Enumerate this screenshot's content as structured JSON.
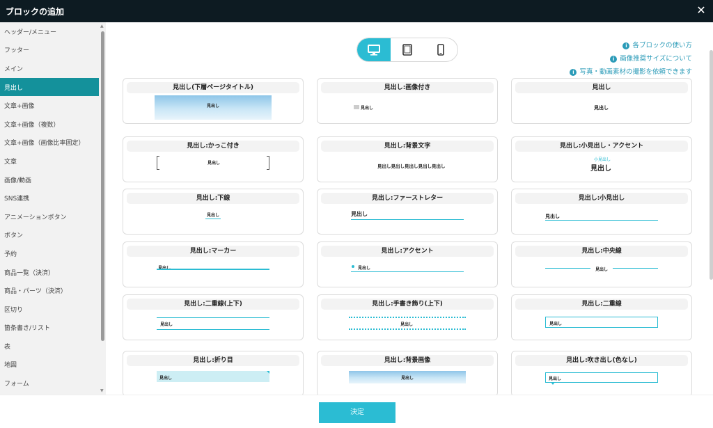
{
  "window": {
    "title": "ブロックの追加"
  },
  "sidebar": {
    "items": [
      {
        "label": "ヘッダー/メニュー"
      },
      {
        "label": "フッター"
      },
      {
        "label": "メイン"
      },
      {
        "label": "見出し",
        "active": true
      },
      {
        "label": "文章+画像"
      },
      {
        "label": "文章+画像（複数）"
      },
      {
        "label": "文章+画像（画像比率固定）"
      },
      {
        "label": "文章"
      },
      {
        "label": "画像/動画"
      },
      {
        "label": "SNS連携"
      },
      {
        "label": "アニメーションボタン"
      },
      {
        "label": "ボタン"
      },
      {
        "label": "予約"
      },
      {
        "label": "商品一覧（決済）"
      },
      {
        "label": "商品・パーツ（決済）"
      },
      {
        "label": "区切り"
      },
      {
        "label": "箇条書き/リスト"
      },
      {
        "label": "表"
      },
      {
        "label": "地図"
      },
      {
        "label": "フォーム"
      }
    ]
  },
  "devices": [
    {
      "icon": "desktop-icon",
      "active": true
    },
    {
      "icon": "tablet-icon",
      "active": false
    },
    {
      "icon": "smartphone-icon",
      "active": false
    }
  ],
  "info_links": [
    "各ブロックの使い方",
    "画像推奨サイズについて",
    "写真・動画素材の撮影を依頼できます"
  ],
  "cards": [
    {
      "title": "見出し(下層ページタイトル)",
      "preview": "見出し"
    },
    {
      "title": "見出し:画像付き",
      "preview": "見出し"
    },
    {
      "title": "見出し",
      "preview": "見出し"
    },
    {
      "title": "見出し:かっこ付き",
      "preview": "見出し"
    },
    {
      "title": "見出し:背景文字",
      "preview": "見出し見出し見出し見出し見出し"
    },
    {
      "title": "見出し:小見出し・アクセント",
      "preview": "見出し",
      "sub": "小見出し"
    },
    {
      "title": "見出し:下線",
      "preview": "見出し"
    },
    {
      "title": "見出し:ファーストレター",
      "preview": "見出し"
    },
    {
      "title": "見出し:小見出し",
      "preview": "見出し"
    },
    {
      "title": "見出し:マーカー",
      "preview": "見出し"
    },
    {
      "title": "見出し:アクセント",
      "preview": "見出し"
    },
    {
      "title": "見出し:中央線",
      "preview": "見出し"
    },
    {
      "title": "見出し:二重線(上下)",
      "preview": "見出し"
    },
    {
      "title": "見出し:手書き飾り(上下)",
      "preview": "見出し"
    },
    {
      "title": "見出し:二重線",
      "preview": "見出し"
    },
    {
      "title": "見出し:折り目",
      "preview": "見出し"
    },
    {
      "title": "見出し:背景画像",
      "preview": "見出し"
    },
    {
      "title": "見出し:吹き出し(色なし)",
      "preview": "見出し"
    }
  ],
  "footer": {
    "decide_label": "決定"
  },
  "colors": {
    "accent": "#2bbcd3",
    "sidebar_active": "#14919b",
    "titlebar": "#0d1b22"
  }
}
